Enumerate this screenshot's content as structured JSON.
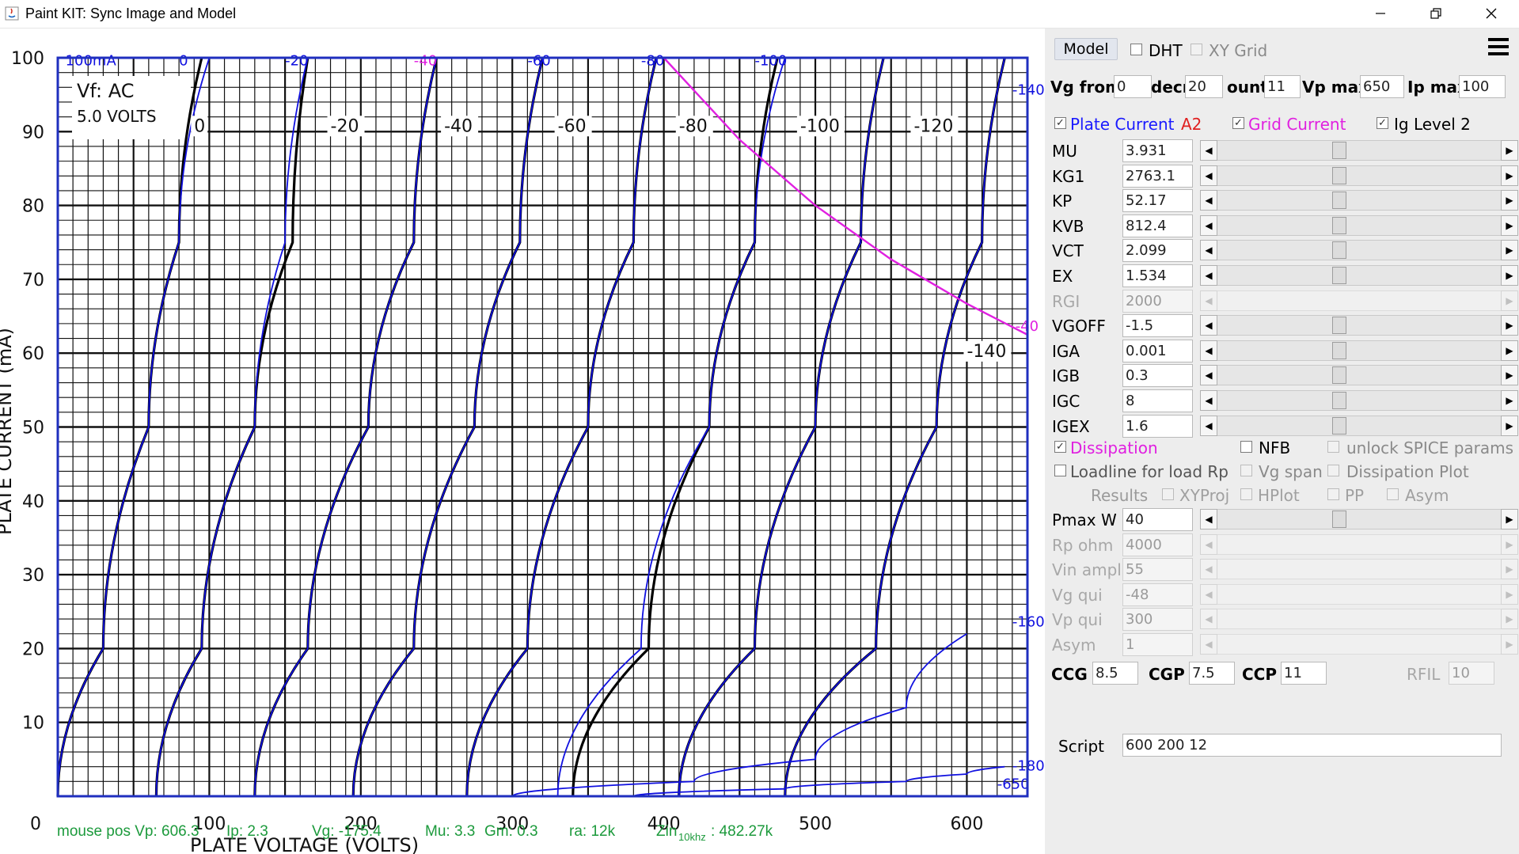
{
  "window": {
    "title": "Paint KIT: Sync Image and Model"
  },
  "chart_data": {
    "type": "line",
    "xlabel": "PLATE VOLTAGE (VOLTS)",
    "ylabel": "PLATE CURRENT (mA)",
    "xlim": [
      0,
      650
    ],
    "ylim": [
      0,
      100
    ],
    "x_ticks": [
      "0",
      "100",
      "200",
      "300",
      "400",
      "500",
      "600"
    ],
    "y_ticks": [
      "0",
      "10",
      "20",
      "30",
      "40",
      "50",
      "60",
      "70",
      "80",
      "90",
      "100"
    ],
    "annotations": [
      "100mA",
      "Vf: AC",
      "5.0 VOLTS"
    ],
    "series": [
      {
        "grid": "0",
        "x": [
          0,
          30,
          60,
          80,
          95
        ],
        "y": [
          0,
          20,
          50,
          75,
          100
        ]
      },
      {
        "grid": "-20",
        "x": [
          65,
          95,
          130,
          155,
          165
        ],
        "y": [
          0,
          20,
          50,
          75,
          100
        ]
      },
      {
        "grid": "-40",
        "x": [
          130,
          165,
          205,
          235,
          250
        ],
        "y": [
          0,
          20,
          50,
          75,
          100
        ]
      },
      {
        "grid": "-60",
        "x": [
          195,
          235,
          275,
          305,
          320
        ],
        "y": [
          0,
          20,
          50,
          75,
          100
        ]
      },
      {
        "grid": "-80",
        "x": [
          270,
          310,
          350,
          380,
          395
        ],
        "y": [
          0,
          20,
          50,
          75,
          100
        ]
      },
      {
        "grid": "-100",
        "x": [
          340,
          390,
          430,
          460,
          475
        ],
        "y": [
          0,
          20,
          50,
          75,
          100
        ]
      },
      {
        "grid": "-120",
        "x": [
          410,
          460,
          500,
          530,
          545
        ],
        "y": [
          0,
          20,
          50,
          75,
          100
        ]
      },
      {
        "grid": "-140",
        "x": [
          480,
          540,
          580,
          610,
          625
        ],
        "y": [
          0,
          20,
          50,
          75,
          100
        ]
      }
    ],
    "curve_labels": [
      {
        "text": "0",
        "x": 90,
        "y": 90
      },
      {
        "text": "-20",
        "x": 180,
        "y": 90
      },
      {
        "text": "-40",
        "x": 255,
        "y": 90
      },
      {
        "text": "-60",
        "x": 330,
        "y": 90
      },
      {
        "text": "-80",
        "x": 410,
        "y": 90
      },
      {
        "text": "-100",
        "x": 490,
        "y": 90
      },
      {
        "text": "-120",
        "x": 565,
        "y": 90
      },
      {
        "text": "-140",
        "x": 600,
        "y": 59.5
      }
    ],
    "model_curves_blue": [
      {
        "label": "0",
        "x": [
          0,
          30,
          60,
          80,
          100
        ],
        "y": [
          0,
          20,
          50,
          75,
          100
        ]
      },
      {
        "label": "-20",
        "x": [
          65,
          95,
          130,
          150,
          165
        ],
        "y": [
          0,
          20,
          50,
          75,
          100
        ]
      },
      {
        "label": "-40",
        "x": [
          130,
          165,
          205,
          235,
          250
        ],
        "y": [
          0,
          20,
          50,
          75,
          100
        ]
      },
      {
        "label": "-60",
        "x": [
          195,
          235,
          275,
          305,
          320
        ],
        "y": [
          0,
          20,
          50,
          75,
          100
        ]
      },
      {
        "label": "-80",
        "x": [
          270,
          310,
          350,
          380,
          395
        ],
        "y": [
          0,
          20,
          50,
          75,
          100
        ]
      },
      {
        "label": "-100",
        "x": [
          330,
          385,
          430,
          460,
          480
        ],
        "y": [
          0,
          20,
          50,
          75,
          100
        ]
      },
      {
        "label": "-120",
        "x": [
          410,
          460,
          500,
          530,
          545
        ],
        "y": [
          0,
          20,
          50,
          75,
          100
        ]
      },
      {
        "label": "-140",
        "x": [
          480,
          540,
          580,
          610,
          625
        ],
        "y": [
          0,
          20,
          50,
          75,
          100
        ]
      },
      {
        "label": "-160",
        "x": [
          300,
          420,
          500,
          560,
          600
        ],
        "y": [
          0,
          2,
          5,
          12,
          22
        ]
      },
      {
        "label": "-180",
        "x": [
          380,
          480,
          560,
          600,
          625
        ],
        "y": [
          0,
          1,
          2,
          3,
          4
        ]
      }
    ],
    "blue_labels": [
      {
        "text": "100mA",
        "x": 5,
        "y": 99
      },
      {
        "text": "0",
        "x": 80,
        "y": 99
      },
      {
        "text": "-20",
        "x": 150,
        "y": 99
      },
      {
        "text": "-40",
        "x": 235,
        "y": 99
      },
      {
        "text": "-60",
        "x": 310,
        "y": 99
      },
      {
        "text": "-80",
        "x": 385,
        "y": 99
      },
      {
        "text": "-100",
        "x": 460,
        "y": 99
      },
      {
        "text": "-140",
        "x": 630,
        "y": 95
      },
      {
        "text": "-40",
        "x": 632,
        "y": 63
      },
      {
        "text": "-160",
        "x": 630,
        "y": 23
      },
      {
        "text": "-180",
        "x": 630,
        "y": 3.5
      },
      {
        "text": "-650",
        "x": 620,
        "y": 1
      }
    ],
    "dissipation_curve": {
      "x": [
        400,
        450,
        500,
        550,
        600,
        640
      ],
      "y": [
        100,
        88.9,
        80,
        72.7,
        66.7,
        62.5
      ],
      "color": "#e020e0"
    }
  },
  "status": {
    "mouse_pos": "mouse pos Vp: 606.3",
    "ip": "Ip: 2.3",
    "vg": "Vg: -175.4",
    "mu": "Mu: 3.3",
    "gm": "Gm: 0.3",
    "ra": "ra: 12k",
    "zin": "Zin",
    "zin_sub": "10khz",
    "zin_val": ": 482.27k",
    "color": "#1c9a3c"
  },
  "panel": {
    "model_button": "Model",
    "dht": {
      "label": "DHT",
      "checked": false
    },
    "xy_grid": {
      "label": "XY Grid",
      "checked": false
    },
    "vg_from": {
      "label": "Vg from",
      "value": "0"
    },
    "decr": {
      "label": "decr",
      "value": "20"
    },
    "count": {
      "label": "ount",
      "value": "11"
    },
    "vp_max": {
      "label": "Vp max",
      "value": "650"
    },
    "ip_max": {
      "label": "Ip max",
      "value": "100"
    },
    "plate_current": {
      "label": "Plate Current",
      "checked": true,
      "color": "#1a1aff"
    },
    "a2": {
      "label": "A2",
      "color": "#e02020"
    },
    "grid_current": {
      "label": "Grid Current",
      "checked": true,
      "color": "#e020e0"
    },
    "ig_level2": {
      "label": "Ig Level 2",
      "checked": true
    },
    "params": [
      {
        "name": "MU",
        "value": "3.931",
        "enabled": true
      },
      {
        "name": "KG1",
        "value": "2763.1",
        "enabled": true
      },
      {
        "name": "KP",
        "value": "52.17",
        "enabled": true
      },
      {
        "name": "KVB",
        "value": "812.4",
        "enabled": true
      },
      {
        "name": "VCT",
        "value": "2.099",
        "enabled": true
      },
      {
        "name": "EX",
        "value": "1.534",
        "enabled": true
      },
      {
        "name": "RGI",
        "value": "2000",
        "enabled": false
      },
      {
        "name": "VGOFF",
        "value": "-1.5",
        "enabled": true
      },
      {
        "name": "IGA",
        "value": "0.001",
        "enabled": true
      },
      {
        "name": "IGB",
        "value": "0.3",
        "enabled": true
      },
      {
        "name": "IGC",
        "value": "8",
        "enabled": true
      },
      {
        "name": "IGEX",
        "value": "1.6",
        "enabled": true
      }
    ],
    "dissipation": {
      "label": "Dissipation",
      "checked": true,
      "color": "#e020e0"
    },
    "nfb": {
      "label": "NFB",
      "checked": false
    },
    "unlock_spice": {
      "label": "unlock SPICE params",
      "checked": false
    },
    "loadline": {
      "label": "Loadline for load Rp",
      "checked": false
    },
    "vg_span": {
      "label": "Vg span",
      "checked": false
    },
    "dissipation_plot": {
      "label": "Dissipation Plot",
      "checked": false
    },
    "results": {
      "label": "Results"
    },
    "xyproj": {
      "label": "XYProj",
      "checked": false
    },
    "hplot": {
      "label": "HPlot",
      "checked": false
    },
    "pp": {
      "label": "PP",
      "checked": false
    },
    "asym_cb": {
      "label": "Asym",
      "checked": false
    },
    "lower_params": [
      {
        "name": "Pmax W",
        "value": "40",
        "enabled": true
      },
      {
        "name": "Rp ohm",
        "value": "4000",
        "enabled": false
      },
      {
        "name": "Vin ampl",
        "value": "55",
        "enabled": false
      },
      {
        "name": "Vg qui",
        "value": "-48",
        "enabled": false
      },
      {
        "name": "Vp qui",
        "value": "300",
        "enabled": false
      },
      {
        "name": "Asym",
        "value": "1",
        "enabled": false
      }
    ],
    "ccg": {
      "label": "CCG",
      "value": "8.5"
    },
    "cgp": {
      "label": "CGP",
      "value": "7.5"
    },
    "ccp": {
      "label": "CCP",
      "value": "11"
    },
    "rfil": {
      "label": "RFIL",
      "value": "10"
    },
    "script": {
      "label": "Script",
      "value": "600 200 12"
    }
  }
}
